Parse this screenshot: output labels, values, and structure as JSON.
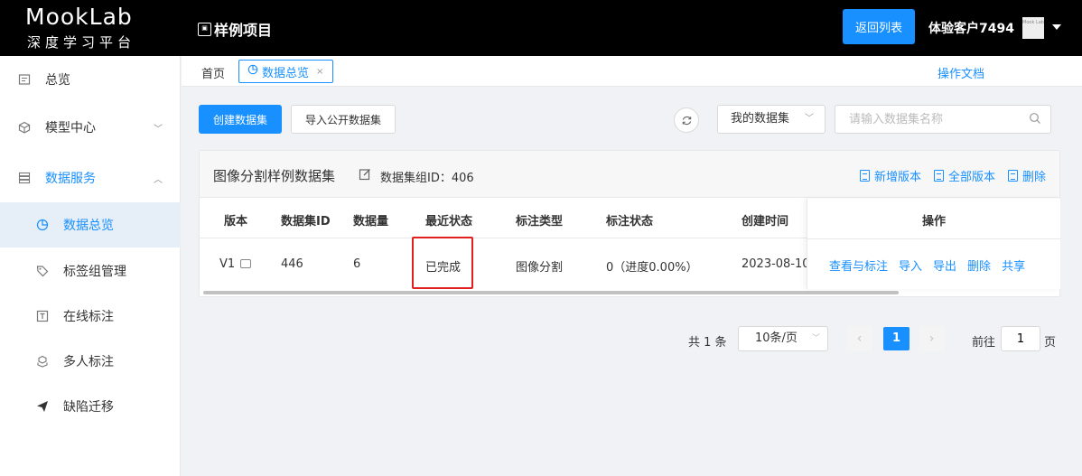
{
  "header": {
    "logo_main": "MookLab",
    "logo_sub": "深度学习平台",
    "project_icon": "project-icon",
    "project_name": "样例项目",
    "back_button": "返回列表",
    "user_name": "体验客户7494",
    "avatar_text": "Mook Lab"
  },
  "sidebar": {
    "items": [
      {
        "label": "总览",
        "icon": "overview-icon"
      },
      {
        "label": "模型中心",
        "icon": "cube-icon"
      },
      {
        "label": "数据服务",
        "icon": "database-icon"
      },
      {
        "label": "数据总览",
        "icon": "pie-chart-icon"
      },
      {
        "label": "标签组管理",
        "icon": "tag-icon"
      },
      {
        "label": "在线标注",
        "icon": "text-icon"
      },
      {
        "label": "多人标注",
        "icon": "group-icon"
      },
      {
        "label": "缺陷迁移",
        "icon": "send-icon"
      }
    ]
  },
  "tabs": {
    "home": "首页",
    "active": "数据总览",
    "doc_link": "操作文档"
  },
  "toolbar": {
    "create": "创建数据集",
    "import": "导入公开数据集",
    "filter_value": "我的数据集",
    "search_placeholder": "请输入数据集名称"
  },
  "dataset": {
    "title": "图像分割样例数据集",
    "group_id": "数据集组ID：406",
    "actions": [
      "新增版本",
      "全部版本",
      "删除"
    ],
    "columns": [
      "版本",
      "数据集ID",
      "数据量",
      "最近状态",
      "标注类型",
      "标注状态",
      "创建时间",
      "操作"
    ],
    "rows": [
      {
        "version": "V1",
        "id": "446",
        "count": "6",
        "status": "已完成",
        "type": "图像分割",
        "progress": "0（进度0.00%）",
        "created": "2023-08-10",
        "ops": [
          "查看与标注",
          "导入",
          "导出",
          "删除",
          "共享"
        ]
      }
    ]
  },
  "pagination": {
    "total": "共 1 条",
    "page_size": "10条/页",
    "current": "1",
    "goto_label": "前往",
    "goto_value": "1",
    "page_unit": "页"
  },
  "colors": {
    "primary": "#1890ff",
    "highlight_box": "#e21f1f",
    "topbar": "#000000"
  }
}
